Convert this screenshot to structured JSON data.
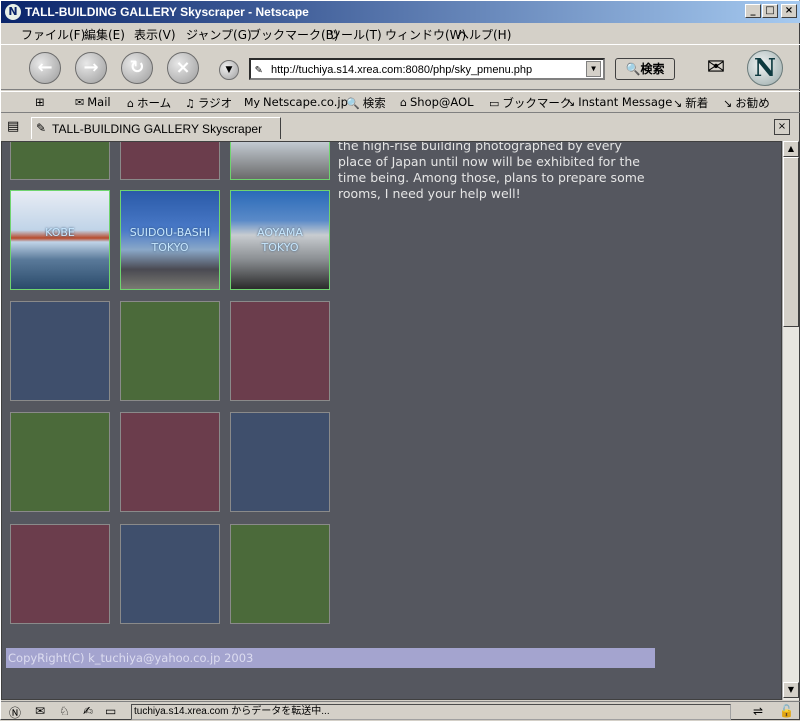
{
  "window": {
    "title": "TALL-BUILDING GALLERY Skyscraper - Netscape",
    "app_icon": "N",
    "minimize_glyph": "_",
    "maximize_glyph": "□",
    "close_glyph": "×"
  },
  "menu": {
    "items": [
      "ファイル(F)",
      "編集(E)",
      "表示(V)",
      "ジャンプ(G)",
      "ブックマーク(B)",
      "ツール(T)",
      "ウィンドウ(W)",
      "ヘルプ(H)"
    ]
  },
  "nav": {
    "back_glyph": "←",
    "forward_glyph": "→",
    "reload_glyph": "↻",
    "stop_glyph": "×",
    "go_glyph": "▼",
    "url_value": "http://tuchiya.s14.xrea.com:8080/php/sky_pmenu.php",
    "search_label": "🔍検索",
    "logo_text": "N",
    "throbber_glyph": "✉"
  },
  "personal_toolbar": {
    "items": [
      {
        "icon": "✉",
        "label": "Mail"
      },
      {
        "icon": "⌂",
        "label": "ホーム"
      },
      {
        "icon": "♫",
        "label": "ラジオ"
      },
      {
        "icon": "My",
        "label": "Netscape.co.jp"
      },
      {
        "icon": "🔍",
        "label": "検索"
      },
      {
        "icon": "⌂",
        "label": "Shop@AOL"
      },
      {
        "icon": "▭",
        "label": "ブックマーク"
      },
      {
        "icon": "↘",
        "label": "Instant Message"
      },
      {
        "icon": "↘",
        "label": "新着"
      },
      {
        "icon": "↘",
        "label": "お勧め"
      }
    ]
  },
  "tab": {
    "title": "TALL-BUILDING GALLERY Skyscraper",
    "close_glyph": "×",
    "new_tab_glyph": "▤"
  },
  "page": {
    "intro_text": "the high-rise building photographed by every place of Japan until now will be exhibited for the time being. Among those, plans to prepare some rooms, I need your help well!",
    "photo_tiles": [
      {
        "line1": "KOBE",
        "line2": ""
      },
      {
        "line1": "SUIDOU-BASHI",
        "line2": "TOKYO"
      },
      {
        "line1": "AOYAMA",
        "line2": "TOKYO"
      }
    ],
    "copyright": "CopyRight(C) k_tuchiya@yahoo.co.jp 2003",
    "colors": {
      "background": "#55575f",
      "tile_green": "#4b6a3a",
      "tile_red": "#6b3d4c",
      "tile_blue": "#3f4f6c",
      "photo_border": "#6fd46f"
    }
  },
  "status": {
    "text": "tuchiya.s14.xrea.com からデータを転送中..."
  }
}
